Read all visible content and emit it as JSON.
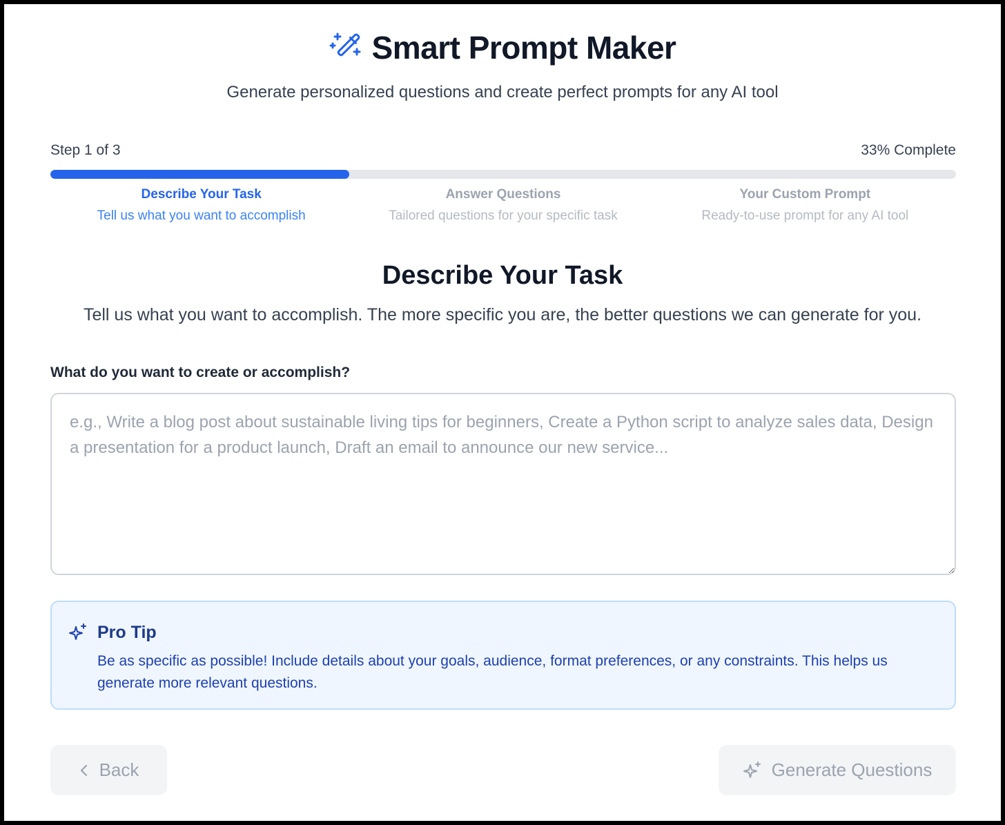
{
  "header": {
    "title": "Smart Prompt Maker",
    "subtitle": "Generate personalized questions and create perfect prompts for any AI tool",
    "icon": "magic-wand-icon"
  },
  "progress": {
    "step_text": "Step 1 of 3",
    "percent_text": "33% Complete",
    "fraction": 0.33,
    "accent_color": "#2563eb"
  },
  "steps": [
    {
      "title": "Describe Your Task",
      "description": "Tell us what you want to accomplish",
      "state": "active"
    },
    {
      "title": "Answer Questions",
      "description": "Tailored questions for your specific task",
      "state": "upcoming"
    },
    {
      "title": "Your Custom Prompt",
      "description": "Ready-to-use prompt for any AI tool",
      "state": "upcoming"
    }
  ],
  "section": {
    "title": "Describe Your Task",
    "description": "Tell us what you want to accomplish. The more specific you are, the better questions we can generate for you."
  },
  "task_field": {
    "label": "What do you want to create or accomplish?",
    "value": "",
    "placeholder": "e.g., Write a blog post about sustainable living tips for beginners, Create a Python script to analyze sales data, Design a presentation for a product launch, Draft an email to announce our new service..."
  },
  "tip": {
    "icon": "sparkle-icon",
    "title": "Pro Tip",
    "text": "Be as specific as possible! Include details about your goals, audience, format preferences, or any constraints. This helps us generate more relevant questions."
  },
  "buttons": {
    "back_label": "Back",
    "back_icon": "chevron-left-icon",
    "generate_label": "Generate Questions",
    "generate_icon": "sparkle-icon"
  }
}
